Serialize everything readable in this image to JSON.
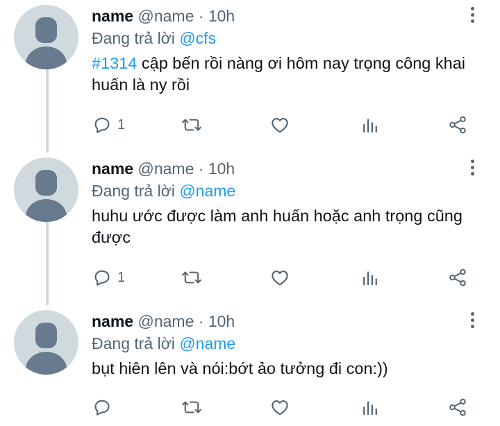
{
  "tweets": [
    {
      "name": "name",
      "handle": "@name",
      "separator": "·",
      "time": "10h",
      "reply_prefix": "Đang trả lời",
      "reply_to": "@cfs",
      "hashtag": "#1314",
      "text": " cập bến rồi nàng ơi hôm nay trọng công khai huấn là ny rồi",
      "reply_count": "1"
    },
    {
      "name": "name",
      "handle": "@name",
      "separator": "·",
      "time": "10h",
      "reply_prefix": "Đang trả lời",
      "reply_to": "@name",
      "text": "huhu ước được làm anh huấn hoặc anh trọng cũng được",
      "reply_count": "1"
    },
    {
      "name": "name",
      "handle": "@name",
      "separator": "·",
      "time": "10h",
      "reply_prefix": "Đang trả lời",
      "reply_to": "@name",
      "text": "bụt hiên lên và nói:bớt ảo tưởng đi con:))",
      "reply_count": ""
    }
  ],
  "icons": {
    "reply": "speech-bubble-icon",
    "retweet": "retweet-icon",
    "like": "heart-icon",
    "stats": "bar-chart-icon",
    "share": "share-icon",
    "more": "vertical-ellipsis-icon"
  },
  "colors": {
    "accent": "#1d9bf0",
    "secondary_text": "#536471",
    "avatar_bg": "#cfd9de",
    "avatar_fg": "#687b8e"
  }
}
